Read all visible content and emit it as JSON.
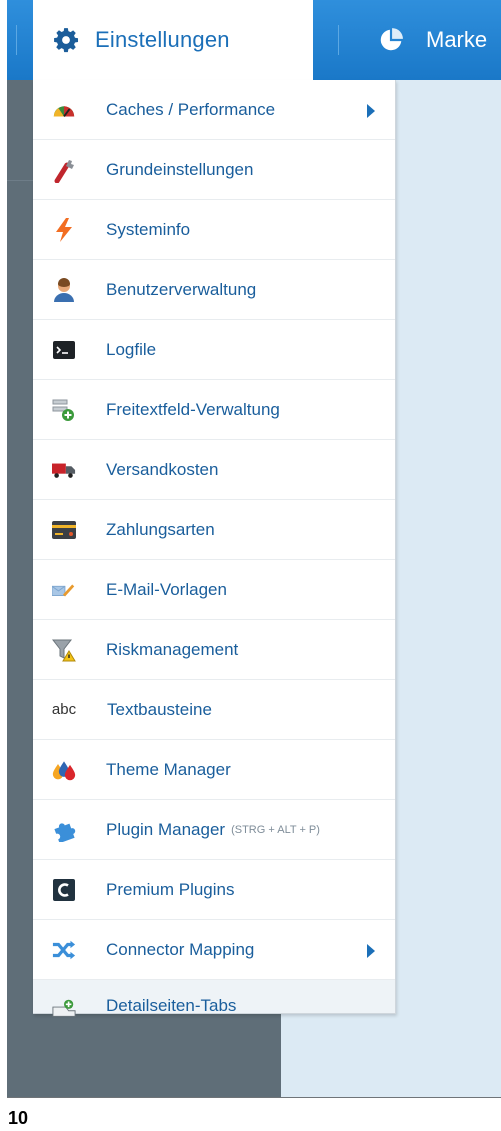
{
  "topbar": {
    "tabs": [
      {
        "label": "Einstellungen",
        "icon": "gear-icon"
      },
      {
        "label": "Marke",
        "icon": "pie-chart-icon"
      }
    ]
  },
  "menu": {
    "items": [
      {
        "label": "Caches / Performance",
        "icon": "speedometer-icon",
        "submenu": true
      },
      {
        "label": "Grundeinstellungen",
        "icon": "wrench-icon"
      },
      {
        "label": "Systeminfo",
        "icon": "lightning-icon"
      },
      {
        "label": "Benutzerverwaltung",
        "icon": "user-icon"
      },
      {
        "label": "Logfile",
        "icon": "terminal-icon"
      },
      {
        "label": "Freitextfeld-Verwaltung",
        "icon": "add-field-icon"
      },
      {
        "label": "Versandkosten",
        "icon": "truck-icon"
      },
      {
        "label": "Zahlungsarten",
        "icon": "credit-card-icon"
      },
      {
        "label": "E-Mail-Vorlagen",
        "icon": "mail-pen-icon"
      },
      {
        "label": "Riskmanagement",
        "icon": "funnel-warning-icon"
      },
      {
        "label": "Textbausteine",
        "icon": "abc-text-icon",
        "icon_text": "abc"
      },
      {
        "label": "Theme Manager",
        "icon": "paint-drops-icon"
      },
      {
        "label": "Plugin Manager",
        "hint": "(STRG + ALT + P)",
        "icon": "puzzle-icon"
      },
      {
        "label": "Premium Plugins",
        "icon": "shopware-logo-icon"
      },
      {
        "label": "Connector Mapping",
        "icon": "shuffle-arrows-icon",
        "submenu": true
      },
      {
        "label": "Detailseiten-Tabs",
        "icon": "add-tab-icon"
      }
    ]
  },
  "footer": {
    "page_number": "10"
  },
  "colors": {
    "accent": "#1b6fb8",
    "topbar": "#2585d4",
    "menu_text": "#1a5e9c"
  }
}
